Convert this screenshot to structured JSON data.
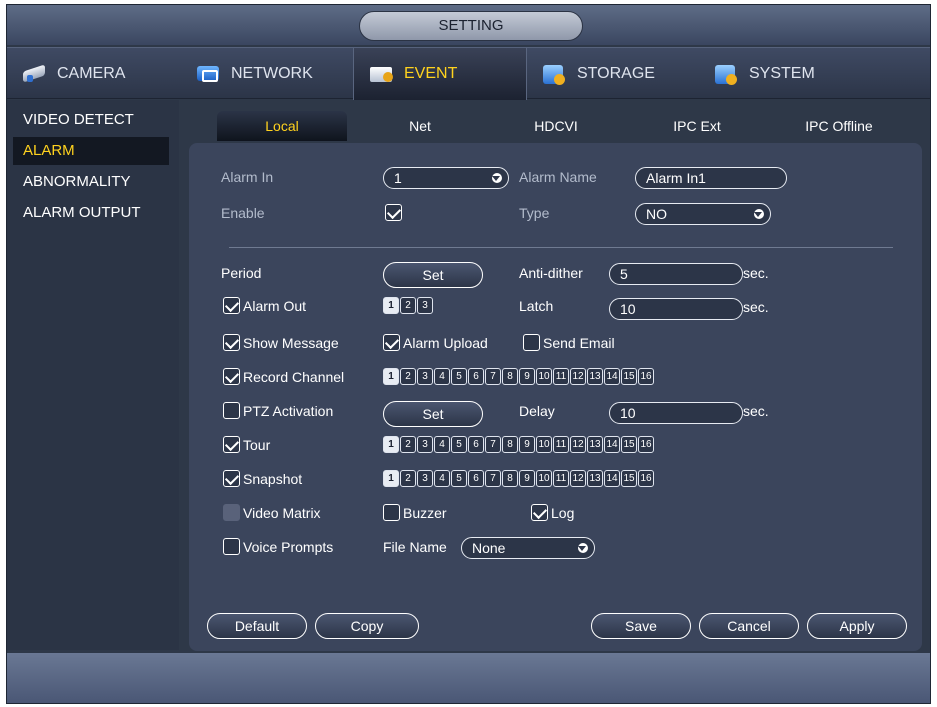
{
  "window": {
    "title": "SETTING"
  },
  "top_tabs": [
    {
      "label": "CAMERA",
      "icon": "camera-icon"
    },
    {
      "label": "NETWORK",
      "icon": "network-icon"
    },
    {
      "label": "EVENT",
      "icon": "event-icon"
    },
    {
      "label": "STORAGE",
      "icon": "storage-icon"
    },
    {
      "label": "SYSTEM",
      "icon": "system-icon"
    }
  ],
  "sidebar": {
    "items": [
      {
        "label": "VIDEO DETECT"
      },
      {
        "label": "ALARM"
      },
      {
        "label": "ABNORMALITY"
      },
      {
        "label": "ALARM OUTPUT"
      }
    ]
  },
  "sub_tabs": [
    {
      "label": "Local"
    },
    {
      "label": "Net"
    },
    {
      "label": "HDCVI"
    },
    {
      "label": "IPC Ext"
    },
    {
      "label": "IPC Offline"
    }
  ],
  "form": {
    "alarm_in_label": "Alarm In",
    "alarm_in_value": "1",
    "alarm_name_label": "Alarm Name",
    "alarm_name_value": "Alarm In1",
    "enable_label": "Enable",
    "type_label": "Type",
    "type_value": "NO",
    "period_label": "Period",
    "set_label": "Set",
    "anti_dither_label": "Anti-dither",
    "anti_dither_value": "5",
    "sec_label": "sec.",
    "alarm_out_label": "Alarm Out",
    "alarm_out_channels": [
      "1",
      "2",
      "3"
    ],
    "latch_label": "Latch",
    "latch_value": "10",
    "show_message_label": "Show Message",
    "alarm_upload_label": "Alarm Upload",
    "send_email_label": "Send Email",
    "record_channel_label": "Record Channel",
    "ptz_activation_label": "PTZ Activation",
    "delay_label": "Delay",
    "delay_value": "10",
    "tour_label": "Tour",
    "snapshot_label": "Snapshot",
    "video_matrix_label": "Video Matrix",
    "buzzer_label": "Buzzer",
    "log_label": "Log",
    "voice_prompts_label": "Voice Prompts",
    "file_name_label": "File Name",
    "file_name_value": "None",
    "channels": [
      "1",
      "2",
      "3",
      "4",
      "5",
      "6",
      "7",
      "8",
      "9",
      "10",
      "11",
      "12",
      "13",
      "14",
      "15",
      "16"
    ]
  },
  "buttons": {
    "default": "Default",
    "copy": "Copy",
    "save": "Save",
    "cancel": "Cancel",
    "apply": "Apply"
  },
  "colors": {
    "accent": "#ffd21e",
    "panel": "#3b455c",
    "background": "#2e3848"
  }
}
